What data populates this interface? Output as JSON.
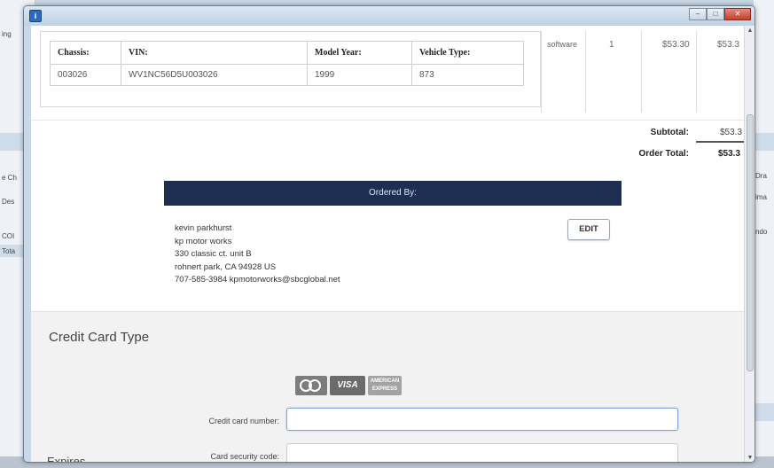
{
  "background": {
    "left_fragments": [
      "ing",
      "e Ch",
      "Des",
      "COI",
      "Tota"
    ],
    "right_fragments": [
      "Dra",
      "ima",
      "ndo"
    ]
  },
  "window": {
    "icon": "app-info-icon",
    "icon_glyph": "i",
    "controls": {
      "minimize": "‒",
      "maximize": "□",
      "close": "✕"
    }
  },
  "vehicle": {
    "headers": [
      "Chassis:",
      "VIN:",
      "Model Year:",
      "Vehicle Type:"
    ],
    "row": [
      "003026",
      "WV1NC56D5U003026",
      "1999",
      "873"
    ]
  },
  "line_item": {
    "category": "software",
    "qty": "1",
    "price": "$53.30",
    "total": "$53.3"
  },
  "totals": {
    "subtotal_label": "Subtotal:",
    "subtotal_value": "$53.3",
    "order_total_label": "Order Total:",
    "order_total_value": "$53.3"
  },
  "ordered_by": {
    "header": "Ordered By:",
    "lines": [
      "kevin parkhurst",
      "kp motor works",
      "330 classic ct. unit B",
      "rohnert park, CA  94928 US",
      "707-585-3984 kpmotorworks@sbcglobal.net"
    ],
    "edit_label": "EDIT"
  },
  "payment": {
    "heading": "Credit Card Type",
    "cards": {
      "mastercard": "mastercard-icon",
      "visa_label": "VISA",
      "amex": "amex-icon",
      "amex_label": "AMERICAN EXPRESS"
    },
    "card_number_label": "Credit card number:",
    "card_number_value": "",
    "security_code_label": "Card security code:",
    "security_code_value": "",
    "next_heading": "Expires"
  }
}
